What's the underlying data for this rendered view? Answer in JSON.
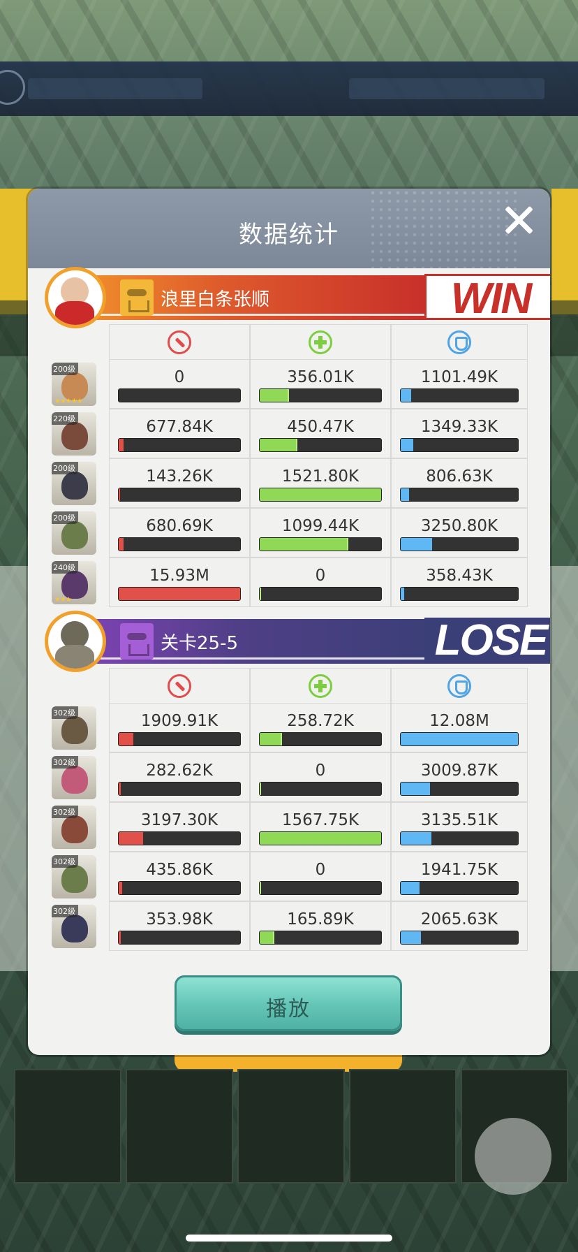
{
  "header": {
    "title": "数据统计"
  },
  "stat_icons": [
    "sword-icon",
    "heal-cross-icon",
    "shield-icon"
  ],
  "teams": [
    {
      "name": "浪里白条张顺",
      "result": "WIN",
      "heroes": [
        {
          "level": "200级",
          "stars": "★★★★★",
          "color": "#c88a55",
          "damage": "0",
          "damage_pct": 0,
          "heal": "356.01K",
          "heal_pct": 0.23,
          "defense": "1101.49K",
          "defense_pct": 0.09
        },
        {
          "level": "220级",
          "stars": "",
          "color": "#7a4b3a",
          "damage": "677.84K",
          "damage_pct": 0.04,
          "heal": "450.47K",
          "heal_pct": 0.3,
          "defense": "1349.33K",
          "defense_pct": 0.11
        },
        {
          "level": "200级",
          "stars": "",
          "color": "#3c3c4a",
          "damage": "143.26K",
          "damage_pct": 0.01,
          "heal": "1521.80K",
          "heal_pct": 1.0,
          "defense": "806.63K",
          "defense_pct": 0.07
        },
        {
          "level": "200级",
          "stars": "",
          "color": "#6b7d4a",
          "damage": "680.69K",
          "damage_pct": 0.04,
          "heal": "1099.44K",
          "heal_pct": 0.72,
          "defense": "3250.80K",
          "defense_pct": 0.27
        },
        {
          "level": "240级",
          "stars": "★★★",
          "color": "#5a3a6a",
          "damage": "15.93M",
          "damage_pct": 1.0,
          "heal": "0",
          "heal_pct": 0,
          "defense": "358.43K",
          "defense_pct": 0.03
        }
      ]
    },
    {
      "name": "关卡25-5",
      "result": "LOSE",
      "heroes": [
        {
          "level": "302级",
          "stars": "",
          "color": "#6a5a44",
          "damage": "1909.91K",
          "damage_pct": 0.12,
          "heal": "258.72K",
          "heal_pct": 0.17,
          "defense": "12.08M",
          "defense_pct": 1.0
        },
        {
          "level": "302级",
          "stars": "",
          "color": "#c25a7a",
          "damage": "282.62K",
          "damage_pct": 0.02,
          "heal": "0",
          "heal_pct": 0,
          "defense": "3009.87K",
          "defense_pct": 0.25
        },
        {
          "level": "302级",
          "stars": "",
          "color": "#8a4a3a",
          "damage": "3197.30K",
          "damage_pct": 0.2,
          "heal": "1567.75K",
          "heal_pct": 1.0,
          "defense": "3135.51K",
          "defense_pct": 0.26
        },
        {
          "level": "302级",
          "stars": "",
          "color": "#6b7d4a",
          "damage": "435.86K",
          "damage_pct": 0.03,
          "heal": "0",
          "heal_pct": 0,
          "defense": "1941.75K",
          "defense_pct": 0.16
        },
        {
          "level": "302级",
          "stars": "",
          "color": "#3a3a5a",
          "damage": "353.98K",
          "damage_pct": 0.02,
          "heal": "165.89K",
          "heal_pct": 0.11,
          "defense": "2065.63K",
          "defense_pct": 0.17
        }
      ]
    }
  ],
  "play_button": {
    "label": "播放"
  },
  "colors": {
    "damage": "#e25149",
    "heal": "#8fd957",
    "defense": "#5fb8f3",
    "win": "#c8302a",
    "lose": "#3b3f78",
    "accent_button": "#66c7b8"
  }
}
